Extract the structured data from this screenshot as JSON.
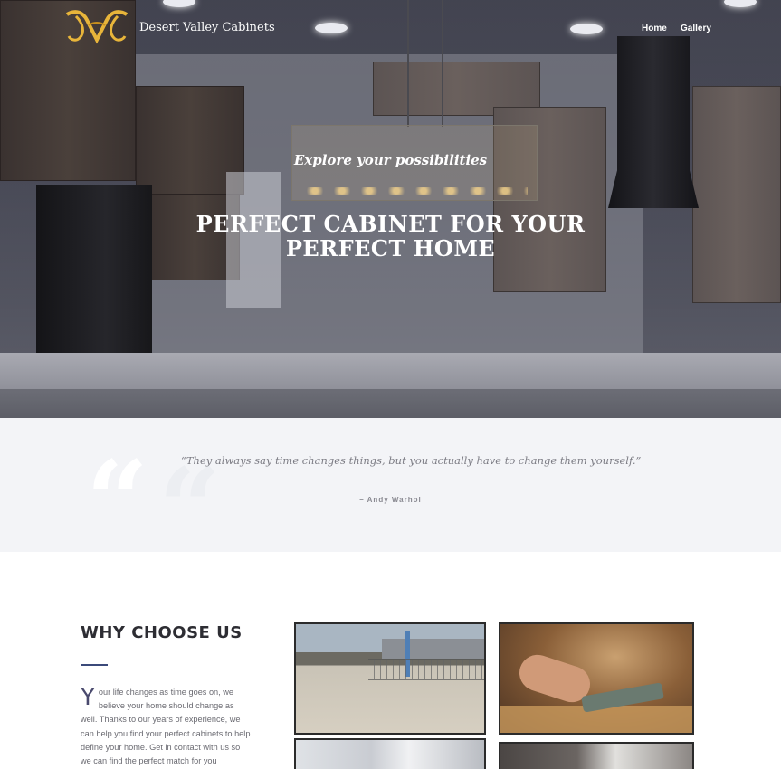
{
  "header": {
    "site_name": "Desert Valley Cabinets",
    "nav": [
      {
        "label": "Home"
      },
      {
        "label": "Gallery"
      }
    ]
  },
  "hero": {
    "subtitle": "Explore your possibilities",
    "title": "PERFECT CABINET FOR YOUR PERFECT HOME"
  },
  "quote": {
    "text": "“They always say time changes things, but you actually have to change them yourself.”",
    "author": "– Andy Warhol",
    "mark": "“"
  },
  "why": {
    "title": "WHY CHOOSE US",
    "dropcap": "Y",
    "body": "our life changes as time goes on, we believe your home should change as well. Thanks to our years of experience, we can help you find your perfect cabinets to help define your home. Get in contact with us so we can find the perfect match for you"
  },
  "colors": {
    "accent": "#3b4a7a",
    "logo_gold": "#e8b53a",
    "quote_bg": "#f3f4f7"
  },
  "icons": [
    "logo-icon",
    "quote-mark-icon"
  ]
}
